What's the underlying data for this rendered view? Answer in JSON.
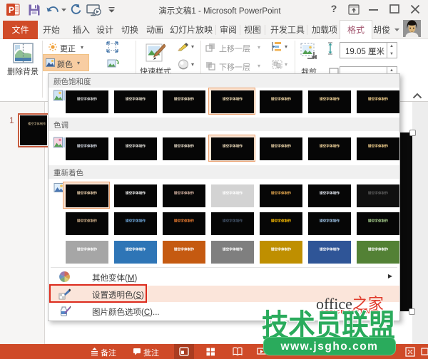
{
  "window": {
    "title": "演示文稿1 - Microsoft PowerPoint",
    "controls": {
      "help": "?",
      "minimize": "–",
      "restore": "❐",
      "close": "✕"
    }
  },
  "tabs": {
    "file": "文件",
    "items": [
      "开始",
      "插入",
      "设计",
      "切换",
      "动画",
      "幻灯片放映",
      "审阅",
      "视图",
      "开发工具",
      "加载项"
    ],
    "active": "格式",
    "user": "胡俊"
  },
  "ribbon": {
    "remove_background": "删除背景",
    "corrections": "更正",
    "color": "颜色",
    "quick_styles": "快速样式",
    "bring_forward": "上移一层",
    "send_backward": "下移一层",
    "crop": "裁剪",
    "height_value": "19.05 厘米"
  },
  "menu": {
    "thumb_text": "镂空字体制作",
    "sections": [
      {
        "title": "颜色饱和度",
        "rows": [
          {
            "selected": 3,
            "bgs": [
              "#060606",
              "#060606",
              "#060606",
              "#060606",
              "#060606",
              "#060606",
              "#060606"
            ],
            "fgs": [
              "#dcdcdc",
              "#e4dccc",
              "#ebdcc0",
              "#f0dcb4",
              "#f4daa8",
              "#f7d89c",
              "#fad690"
            ]
          }
        ]
      },
      {
        "title": "色调",
        "rows": [
          {
            "selected": 3,
            "bgs": [
              "#060606",
              "#060606",
              "#060606",
              "#060606",
              "#060606",
              "#060606",
              "#060606"
            ],
            "fgs": [
              "#d8dee8",
              "#e0ded8",
              "#e7dcc9",
              "#eddbba",
              "#f1d9ac",
              "#f5d79e",
              "#f8d590"
            ]
          }
        ]
      },
      {
        "title": "重新着色",
        "rows": [
          {
            "selected": 0,
            "bgs": [
              "#060606",
              "#060606",
              "#060606",
              "#d3d3d3",
              "#060606",
              "#060606",
              "#101010"
            ],
            "fgs": [
              "#efd3ae",
              "#f2f2f2",
              "#dcb9a8",
              "#ffffff",
              "#e8aa50",
              "#e4e9f2",
              "#5f5f5f"
            ]
          },
          {
            "selected": -1,
            "bgs": [
              "#060606",
              "#060606",
              "#060606",
              "#060606",
              "#060606",
              "#060606",
              "#060606"
            ],
            "fgs": [
              "#d0b08a",
              "#6fa8dc",
              "#ed7d31",
              "#44546a",
              "#ffc000",
              "#9dc3e6",
              "#a9d18e"
            ]
          },
          {
            "selected": -1,
            "bgs": [
              "#a6a6a6",
              "#2e75b6",
              "#c55a11",
              "#7f7f7f",
              "#bf8f00",
              "#2f5597",
              "#538135"
            ],
            "fgs": [
              "#ffffff",
              "#ffffff",
              "#ffffff",
              "#ffffff",
              "#ffffff",
              "#ffffff",
              "#ffffff"
            ]
          }
        ]
      }
    ],
    "items": [
      {
        "label": "其他变体",
        "accel": "M",
        "suffix": "",
        "submenu": "▶"
      },
      {
        "label": "设置透明色",
        "accel": "S",
        "suffix": ""
      },
      {
        "label": "图片颜色选项",
        "accel": "C",
        "suffix": "..."
      }
    ]
  },
  "slide_panel": {
    "slide_number": "1",
    "thumb_text": "镂空字体制作"
  },
  "status_bar": {
    "notes": "备注",
    "comments": "批注"
  },
  "watermarks": {
    "office_black": "office",
    "office_red": "之家",
    "jb51": "OFFICE.JB51.NET",
    "league": "技术员联盟",
    "url": "www.jsgho.com"
  }
}
